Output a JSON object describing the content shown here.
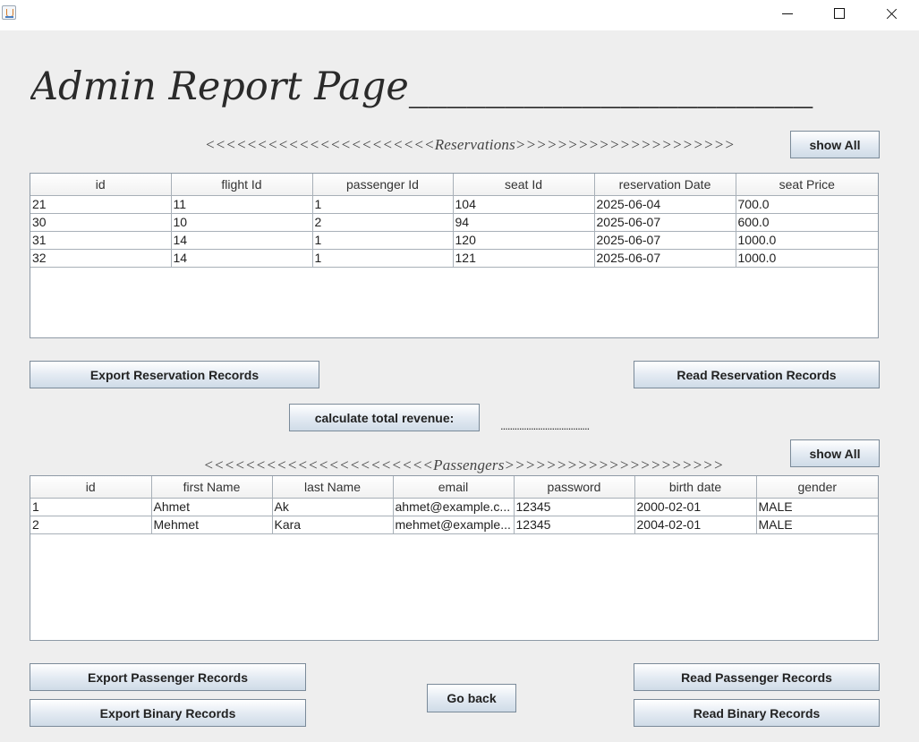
{
  "window": {
    "title": ""
  },
  "page_title": "Admin Report Page_____________________",
  "reservations": {
    "section_label": "<<<<<<<<<<<<<<<<<<<<<<Reservations>>>>>>>>>>>>>>>>>>>>>",
    "show_all_label": "show All",
    "columns": [
      "id",
      "flight Id",
      "passenger Id",
      "seat Id",
      "reservation Date",
      "seat Price"
    ],
    "rows": [
      [
        "21",
        "11",
        "1",
        "104",
        "2025-06-04",
        "700.0"
      ],
      [
        "30",
        "10",
        "2",
        "94",
        "2025-06-07",
        "600.0"
      ],
      [
        "31",
        "14",
        "1",
        "120",
        "2025-06-07",
        "1000.0"
      ],
      [
        "32",
        "14",
        "1",
        "121",
        "2025-06-07",
        "1000.0"
      ]
    ],
    "export_label": "Export Reservation Records",
    "read_label": "Read Reservation Records"
  },
  "revenue": {
    "button_label": "calculate total revenue:",
    "value": "......................................"
  },
  "passengers": {
    "section_label": "<<<<<<<<<<<<<<<<<<<<<<Passengers>>>>>>>>>>>>>>>>>>>>>",
    "show_all_label": "show All",
    "columns": [
      "id",
      "first Name",
      "last Name",
      "email",
      "password",
      "birth date",
      "gender"
    ],
    "rows": [
      [
        "1",
        "Ahmet",
        "Ak",
        "ahmet@example.c...",
        "12345",
        "2000-02-01",
        "MALE"
      ],
      [
        "2",
        "Mehmet",
        "Kara",
        "mehmet@example...",
        "12345",
        "2004-02-01",
        "MALE"
      ]
    ],
    "export_label": "Export Passenger Records",
    "read_label": "Read Passenger Records"
  },
  "binary": {
    "export_label": "Export Binary Records",
    "read_label": "Read Binary Records"
  },
  "go_back_label": "Go back",
  "icons": {
    "app": "java-app-icon",
    "minimize": "minimize-icon",
    "maximize": "maximize-icon",
    "close": "close-icon"
  }
}
